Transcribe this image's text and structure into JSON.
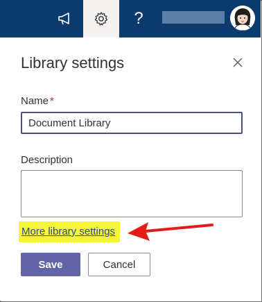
{
  "topbar": {
    "icons": [
      "megaphone-icon",
      "gear-icon",
      "help-icon"
    ],
    "help_glyph": "?",
    "bg_color": "#0b3a6e"
  },
  "panel": {
    "title": "Library settings",
    "name_label": "Name",
    "required_mark": "*",
    "name_value": "Document Library",
    "description_label": "Description",
    "description_value": "",
    "more_link": "More library settings",
    "save_label": "Save",
    "cancel_label": "Cancel"
  },
  "colors": {
    "accent": "#6264a7",
    "link": "#2b4a8f",
    "highlight": "#f5f53a",
    "annotation_arrow": "#e31b1b"
  }
}
